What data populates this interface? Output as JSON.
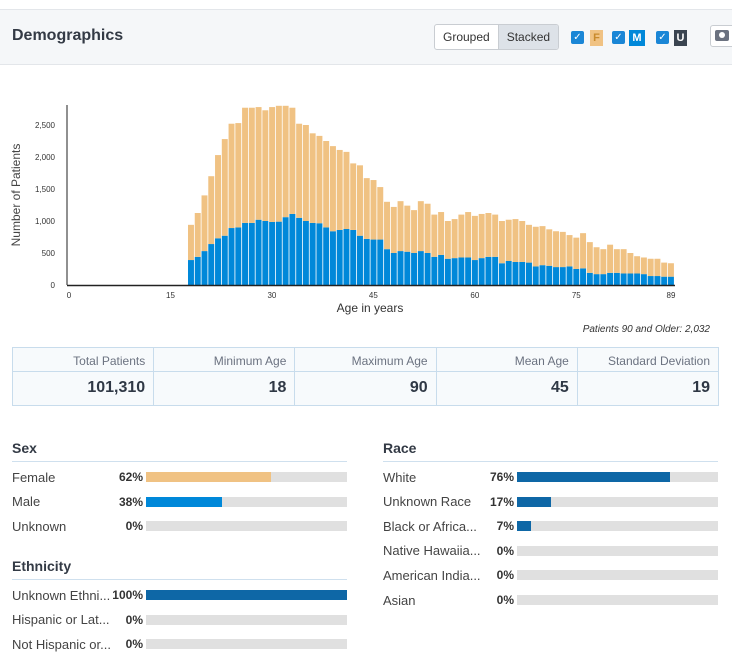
{
  "header": {
    "title": "Demographics",
    "mode_options": [
      "Grouped",
      "Stacked"
    ],
    "selected_mode": "Stacked",
    "legend": [
      {
        "key": "F",
        "checked": true,
        "color": "#f0c283"
      },
      {
        "key": "M",
        "checked": true,
        "color": "#0088d9"
      },
      {
        "key": "U",
        "checked": true,
        "color": "#3a4450"
      }
    ],
    "camera_icon": "camera-icon"
  },
  "colors": {
    "female": "#f0c283",
    "male": "#0088d9",
    "bar_fill": "#0e67a6",
    "track": "#e0e0e0"
  },
  "chart_data": {
    "type": "bar",
    "stacked": true,
    "xlabel": "Age in years",
    "ylabel": "Number of Patients",
    "xlim": [
      0,
      89
    ],
    "ylim": [
      0,
      2800
    ],
    "x_ticks": [
      "0",
      "15",
      "30",
      "45",
      "60",
      "75",
      "89"
    ],
    "y_ticks": [
      "0",
      "500",
      "1,000",
      "1,500",
      "2,000",
      "2,500"
    ],
    "y_tick_values": [
      0,
      500,
      1000,
      1500,
      2000,
      2500
    ],
    "ages": [
      18,
      19,
      20,
      21,
      22,
      23,
      24,
      25,
      26,
      27,
      28,
      29,
      30,
      31,
      32,
      33,
      34,
      35,
      36,
      37,
      38,
      39,
      40,
      41,
      42,
      43,
      44,
      45,
      46,
      47,
      48,
      49,
      50,
      51,
      52,
      53,
      54,
      55,
      56,
      57,
      58,
      59,
      60,
      61,
      62,
      63,
      64,
      65,
      66,
      67,
      68,
      69,
      70,
      71,
      72,
      73,
      74,
      75,
      76,
      77,
      78,
      79,
      80,
      81,
      82,
      83,
      84,
      85,
      86,
      87,
      88,
      89
    ],
    "series": [
      {
        "name": "M",
        "values": [
          390,
          440,
          530,
          640,
          730,
          770,
          890,
          900,
          970,
          970,
          1020,
          1000,
          985,
          990,
          1060,
          1110,
          1050,
          1000,
          970,
          965,
          900,
          840,
          860,
          875,
          860,
          770,
          720,
          710,
          710,
          560,
          500,
          530,
          520,
          500,
          530,
          500,
          440,
          470,
          410,
          420,
          430,
          430,
          390,
          420,
          440,
          440,
          340,
          375,
          360,
          360,
          350,
          290,
          310,
          300,
          280,
          280,
          290,
          250,
          260,
          190,
          170,
          170,
          190,
          190,
          180,
          180,
          180,
          170,
          140,
          140,
          130,
          130
        ]
      },
      {
        "name": "F",
        "values": [
          550,
          685,
          870,
          1060,
          1300,
          1510,
          1630,
          1630,
          1800,
          1800,
          1760,
          1730,
          1795,
          1810,
          1740,
          1660,
          1470,
          1500,
          1400,
          1365,
          1350,
          1330,
          1250,
          1205,
          1040,
          1100,
          950,
          930,
          820,
          740,
          720,
          780,
          720,
          670,
          780,
          770,
          660,
          670,
          590,
          610,
          670,
          710,
          690,
          690,
          685,
          660,
          660,
          645,
          670,
          640,
          590,
          620,
          610,
          570,
          560,
          550,
          490,
          490,
          550,
          480,
          420,
          390,
          440,
          370,
          380,
          320,
          270,
          260,
          270,
          270,
          220,
          210
        ]
      }
    ],
    "legend": [
      "F",
      "M",
      "U"
    ]
  },
  "over90": "Patients 90 and Older: 2,032",
  "stats": [
    {
      "label": "Total Patients",
      "value": "101,310"
    },
    {
      "label": "Minimum Age",
      "value": "18"
    },
    {
      "label": "Maximum Age",
      "value": "90"
    },
    {
      "label": "Mean Age",
      "value": "45"
    },
    {
      "label": "Standard Deviation",
      "value": "19"
    }
  ],
  "sex": {
    "title": "Sex",
    "rows": [
      {
        "label": "Female",
        "pct": "62%",
        "value": 0.62,
        "color": "#f0c283"
      },
      {
        "label": "Male",
        "pct": "38%",
        "value": 0.38,
        "color": "#0088d9"
      },
      {
        "label": "Unknown",
        "pct": "0%",
        "value": 0,
        "color": "#0e67a6"
      }
    ]
  },
  "ethnicity": {
    "title": "Ethnicity",
    "rows": [
      {
        "label": "Unknown Ethni...",
        "pct": "100%",
        "value": 1.0,
        "color": "#0e67a6"
      },
      {
        "label": "Hispanic or Lat...",
        "pct": "0%",
        "value": 0,
        "color": "#0e67a6"
      },
      {
        "label": "Not Hispanic or...",
        "pct": "0%",
        "value": 0,
        "color": "#0e67a6"
      }
    ]
  },
  "race": {
    "title": "Race",
    "rows": [
      {
        "label": "White",
        "pct": "76%",
        "value": 0.76,
        "color": "#0e67a6"
      },
      {
        "label": "Unknown Race",
        "pct": "17%",
        "value": 0.17,
        "color": "#0e67a6"
      },
      {
        "label": "Black or Africa...",
        "pct": "7%",
        "value": 0.07,
        "color": "#0e67a6"
      },
      {
        "label": "Native Hawaiia...",
        "pct": "0%",
        "value": 0,
        "color": "#0e67a6"
      },
      {
        "label": "American India...",
        "pct": "0%",
        "value": 0,
        "color": "#0e67a6"
      },
      {
        "label": "Asian",
        "pct": "0%",
        "value": 0,
        "color": "#0e67a6"
      }
    ]
  }
}
